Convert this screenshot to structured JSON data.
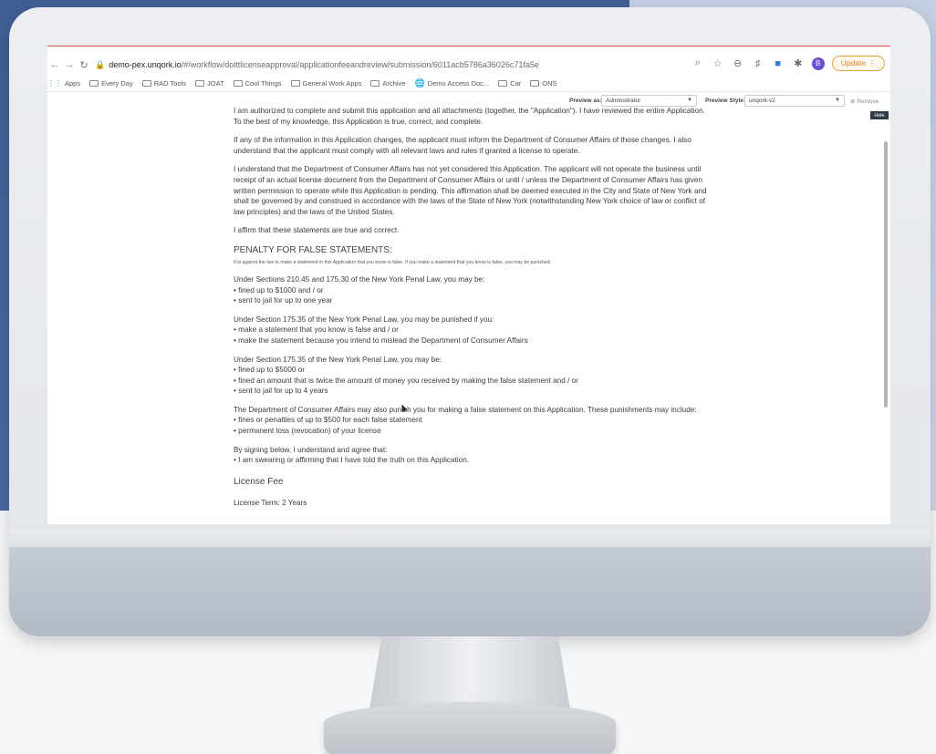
{
  "browser": {
    "url_host": "demo-pex.unqork.io",
    "url_path": "/#/workflow/dolttlicenseapproval/applicationfeeandreview/submission/6011acb5786a36026c71fa5e",
    "update_label": "Update",
    "profile_initial": "B"
  },
  "bookmarks": [
    {
      "label": "Apps"
    },
    {
      "label": "Every Day"
    },
    {
      "label": "RAD Tools"
    },
    {
      "label": "JOAT"
    },
    {
      "label": "Cool Things"
    },
    {
      "label": "General Work Apps"
    },
    {
      "label": "Archive"
    },
    {
      "label": "Demo Access Doc..."
    },
    {
      "label": "Car"
    },
    {
      "label": "ONS"
    }
  ],
  "preview": {
    "as_label": "Preview as:",
    "as_value": "Administrator",
    "style_label": "Preview Style:",
    "style_value": "unqork-v2",
    "remove_label": "Remove",
    "hide_label": "Hide"
  },
  "content": {
    "para1": "I am authorized to complete and submit this application and all attachments (together, the \"Application\"). I have reviewed the entire Application. To the best of my knowledge, this Application is true, correct, and complete.",
    "para2": "If any of the information in this Application changes, the applicant must inform the Department of Consumer Affairs of those changes. I also understand that the applicant must comply with all relevant laws and rules if granted a license to operate.",
    "para3": "I understand that the Department of Consumer Affairs has not yet considered this Application. The applicant will not operate the business until receipt of an actual license document from the Department of Consumer Affairs or until / unless the Department of Consumer Affairs has given written permission to operate while this Application is pending. This affirmation shall be deemed executed in the City and State of New York and shall be governed by and construed in accordance with the laws of the State of New York (notwithstanding New York choice of law or conflict of law principles) and the laws of the United States.",
    "para4": "I affirm that these statements are true and correct.",
    "penalty_heading": "PENALTY FOR FALSE STATEMENTS:",
    "penalty_small": "It is against the law to make a statement in this Application that you know is false. If you make a statement that you know is false, you may be punished.",
    "sec1_intro": "Under Sections 210.45 and 175.30 of the New York Penal Law, you may be:",
    "sec1_b1": "fined up to $1000 and / or",
    "sec1_b2": "sent to jail for up to one year",
    "sec2_intro": "Under Section 175.35 of the New York Penal Law, you may be punished if you:",
    "sec2_b1": "make a statement that you know is false and / or",
    "sec2_b2": "make the statement because you intend to mislead the Department of Consumer Affairs",
    "sec3_intro": "Under Section 175.35 of the New York Penal Law, you may be:",
    "sec3_b1": "fined up to $5000 or",
    "sec3_b2": "fined an amount that is twice the amount of money you received by making the false statement and / or",
    "sec3_b3": "sent to jail for up to 4 years",
    "sec4_intro": "The Department of Consumer Affairs may also punish you for making a false statement on this Application. These punishments may include:",
    "sec4_b1": "fines or penalties of up to $500 for each false statement",
    "sec4_b2": "permanent loss (revocation) of your license",
    "sec5_intro": "By signing below, I understand and agree that:",
    "sec5_b1": "I am swearing or affirming that I have told the truth on this Application.",
    "license_fee": "License Fee",
    "license_term": "License Term: 2 Years"
  }
}
